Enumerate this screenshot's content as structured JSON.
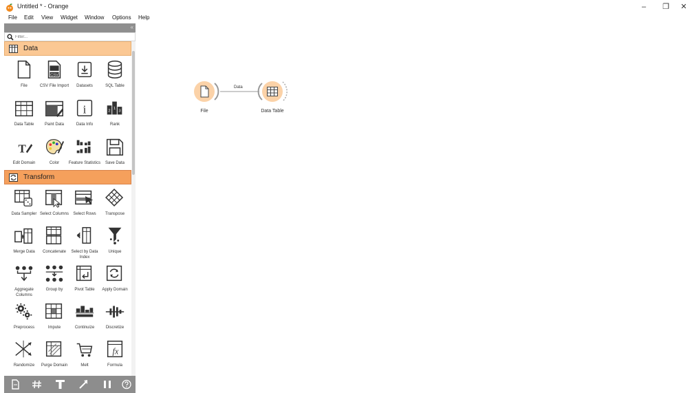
{
  "window": {
    "title": "Untitled * - Orange",
    "controls": [
      "–",
      "❐",
      "✕"
    ]
  },
  "menu": [
    "File",
    "Edit",
    "View",
    "Widget",
    "Window",
    "Options",
    "Help"
  ],
  "sidebar": {
    "close_glyph": "«",
    "filter_placeholder": "Filter...",
    "categories": [
      {
        "name": "Data",
        "widgets": [
          "File",
          "CSV File Import",
          "Datasets",
          "SQL Table",
          "Data Table",
          "Paint Data",
          "Data Info",
          "Rank",
          "Edit Domain",
          "Color",
          "Feature Statistics",
          "Save Data"
        ]
      },
      {
        "name": "Transform",
        "widgets": [
          "Data Sampler",
          "Select Columns",
          "Select Rows",
          "Transpose",
          "Merge Data",
          "Concatenate",
          "Select by Data Index",
          "Unique",
          "Aggregate Columns",
          "Group by",
          "Pivot Table",
          "Apply Domain",
          "Preprocess",
          "Impute",
          "Continuize",
          "Discretize",
          "Randomize",
          "Purge Domain",
          "Melt",
          "Formula"
        ]
      }
    ],
    "toolbar_icons": [
      "file-icon",
      "grid-icon",
      "text-annotation-icon",
      "arrow-annotation-icon",
      "pause-icon",
      "help-icon"
    ]
  },
  "canvas": {
    "nodes": [
      {
        "id": "file",
        "label": "File",
        "icon": "file-icon"
      },
      {
        "id": "data-table",
        "label": "Data Table",
        "icon": "table-icon"
      }
    ],
    "links": [
      {
        "from": "file",
        "to": "data-table",
        "label": "Data"
      }
    ]
  },
  "colors": {
    "category_data": "#fbc894",
    "category_transform": "#f5a05c",
    "node_circle": "#fbd2a8",
    "node_ring": "#f0a55f",
    "dock_header": "#8f8f8f"
  }
}
